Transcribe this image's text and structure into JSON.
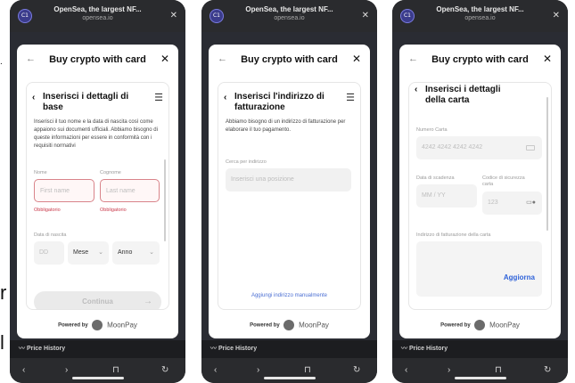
{
  "edge_text": {
    "dot": ".",
    "r": "r",
    "l": "l"
  },
  "browser": {
    "title": "OpenSea, the largest NF...",
    "url": "opensea.io",
    "avatar": "C1"
  },
  "modal": {
    "title": "Buy crypto with card",
    "powered_by": "Powered by",
    "provider": "MoonPay"
  },
  "background": {
    "price_history": "Price History"
  },
  "screen1": {
    "heading": "Inserisci i dettagli di base",
    "description": "Inserisci il tuo nome e la data di nascita così come appaiono sui documenti ufficiali. Abbiamo bisogno di queste informazioni per essere in conformità con i requisiti normativi",
    "first_name_label": "Nome",
    "first_name_placeholder": "First name",
    "last_name_label": "Cognome",
    "last_name_placeholder": "Last name",
    "required_error": "Obbligatorio",
    "dob_label": "Data di nascita",
    "day_placeholder": "DD",
    "month_placeholder": "Mese",
    "year_placeholder": "Anno",
    "continue_label": "Continua"
  },
  "screen2": {
    "heading": "Inserisci l'indirizzo di fatturazione",
    "description": "Abbiamo bisogno di un indirizzo di fatturazione per elaborare il tuo pagamento.",
    "search_label": "Cerca per indirizzo",
    "search_placeholder": "Inserisci una posizione",
    "manual_link": "Aggiungi indirizzo manualmente"
  },
  "screen3": {
    "heading": "Inserisci i dettagli della carta",
    "card_number_label": "Numero Carta",
    "card_number_placeholder": "4242 4242 4242 4242",
    "expiry_label": "Data di scadenza",
    "expiry_placeholder": "MM / YY",
    "cvc_label": "Codice di sicurezza carta",
    "cvc_placeholder": "123",
    "billing_label": "Indirizzo di fatturazione della carta",
    "update_label": "Aggiorna"
  }
}
